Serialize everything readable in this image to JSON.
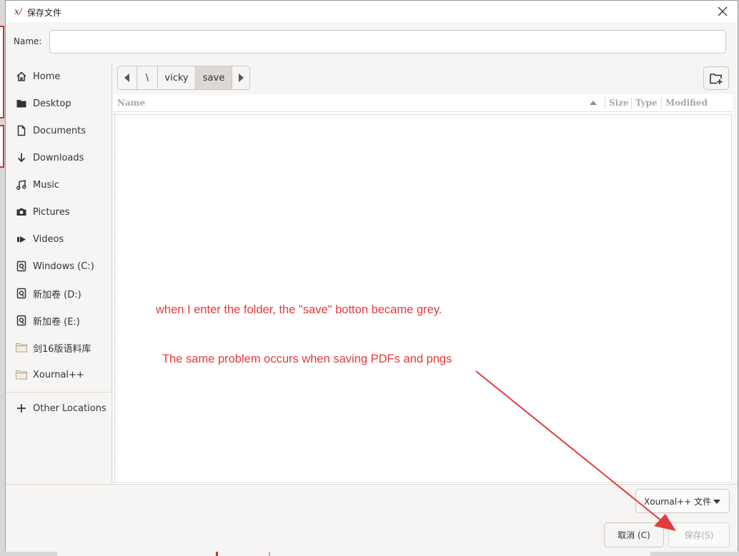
{
  "window": {
    "title": "保存文件",
    "icon": "xournal-app-icon"
  },
  "name_row": {
    "label": "Name:",
    "value": "",
    "placeholder": ""
  },
  "sidebar": {
    "items": [
      {
        "label": "Home",
        "icon": "home-icon"
      },
      {
        "label": "Desktop",
        "icon": "folder-icon"
      },
      {
        "label": "Documents",
        "icon": "document-icon"
      },
      {
        "label": "Downloads",
        "icon": "download-icon"
      },
      {
        "label": "Music",
        "icon": "music-icon"
      },
      {
        "label": "Pictures",
        "icon": "camera-icon"
      },
      {
        "label": "Videos",
        "icon": "video-icon"
      },
      {
        "label": "Windows (C:)",
        "icon": "drive-icon"
      },
      {
        "label": "新加卷 (D:)",
        "icon": "drive-icon"
      },
      {
        "label": "新加卷 (E:)",
        "icon": "drive-icon"
      },
      {
        "label": "剑16版语料库",
        "icon": "folder-bookmark-icon"
      },
      {
        "label": "Xournal++",
        "icon": "folder-bookmark-icon"
      }
    ],
    "other_locations": {
      "label": "Other Locations",
      "icon": "plus-icon"
    }
  },
  "pathbar": {
    "segments": [
      {
        "label": "\\"
      },
      {
        "label": "vicky"
      },
      {
        "label": "save",
        "active": true
      }
    ]
  },
  "file_list": {
    "columns": {
      "name": "Name",
      "size": "Size",
      "type": "Type",
      "modified": "Modified"
    },
    "rows": []
  },
  "annotations": {
    "line1": "when I enter the folder, the \"save\" botton became grey.",
    "line2": "The same problem occurs when saving PDFs and pngs",
    "color": "#e33b3b"
  },
  "footer": {
    "filter_label": "Xournal++ 文件",
    "cancel_label": "取消 (C)",
    "save_label": "保存(S)",
    "save_disabled": true
  }
}
